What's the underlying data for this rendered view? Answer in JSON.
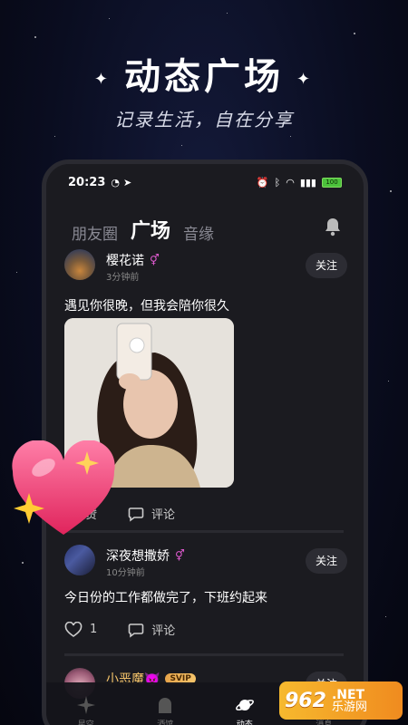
{
  "hero": {
    "title": "动态广场",
    "subtitle": "记录生活，自在分享"
  },
  "status_bar": {
    "time": "20:23",
    "battery": "100"
  },
  "tabs": [
    {
      "label": "朋友圈",
      "active": false
    },
    {
      "label": "广场",
      "active": true
    },
    {
      "label": "音缘",
      "active": false
    }
  ],
  "posts": [
    {
      "username": "樱花诺",
      "time": "3分钟前",
      "gender_icon": "female",
      "follow_label": "关注",
      "text": "遇见你很晚，但我会陪你很久",
      "like_label": "点赞",
      "comment_label": "评论"
    },
    {
      "username": "深夜想撒娇",
      "time": "10分钟前",
      "gender_icon": "female",
      "follow_label": "关注",
      "text": "今日份的工作都做完了，下班约起来",
      "like_count": "1",
      "comment_label": "评论"
    },
    {
      "username": "小恶魔👿",
      "badge": "SVIP",
      "follow_label": "关注"
    }
  ],
  "bottom_nav": [
    {
      "label": "星空",
      "icon": "sparkle-icon",
      "active": false
    },
    {
      "label": "酒馆",
      "icon": "tavern-icon",
      "active": false
    },
    {
      "label": "动态",
      "icon": "planet-icon",
      "active": true
    },
    {
      "label": "消息",
      "icon": "chat-icon",
      "active": false
    }
  ],
  "watermark": {
    "number": "962",
    "net": ".NET",
    "cn": "乐游网"
  },
  "colors": {
    "accent_pink": "#e05ad0",
    "svip_gold": "#f5c46a",
    "watermark_orange": "#f08b1f"
  }
}
